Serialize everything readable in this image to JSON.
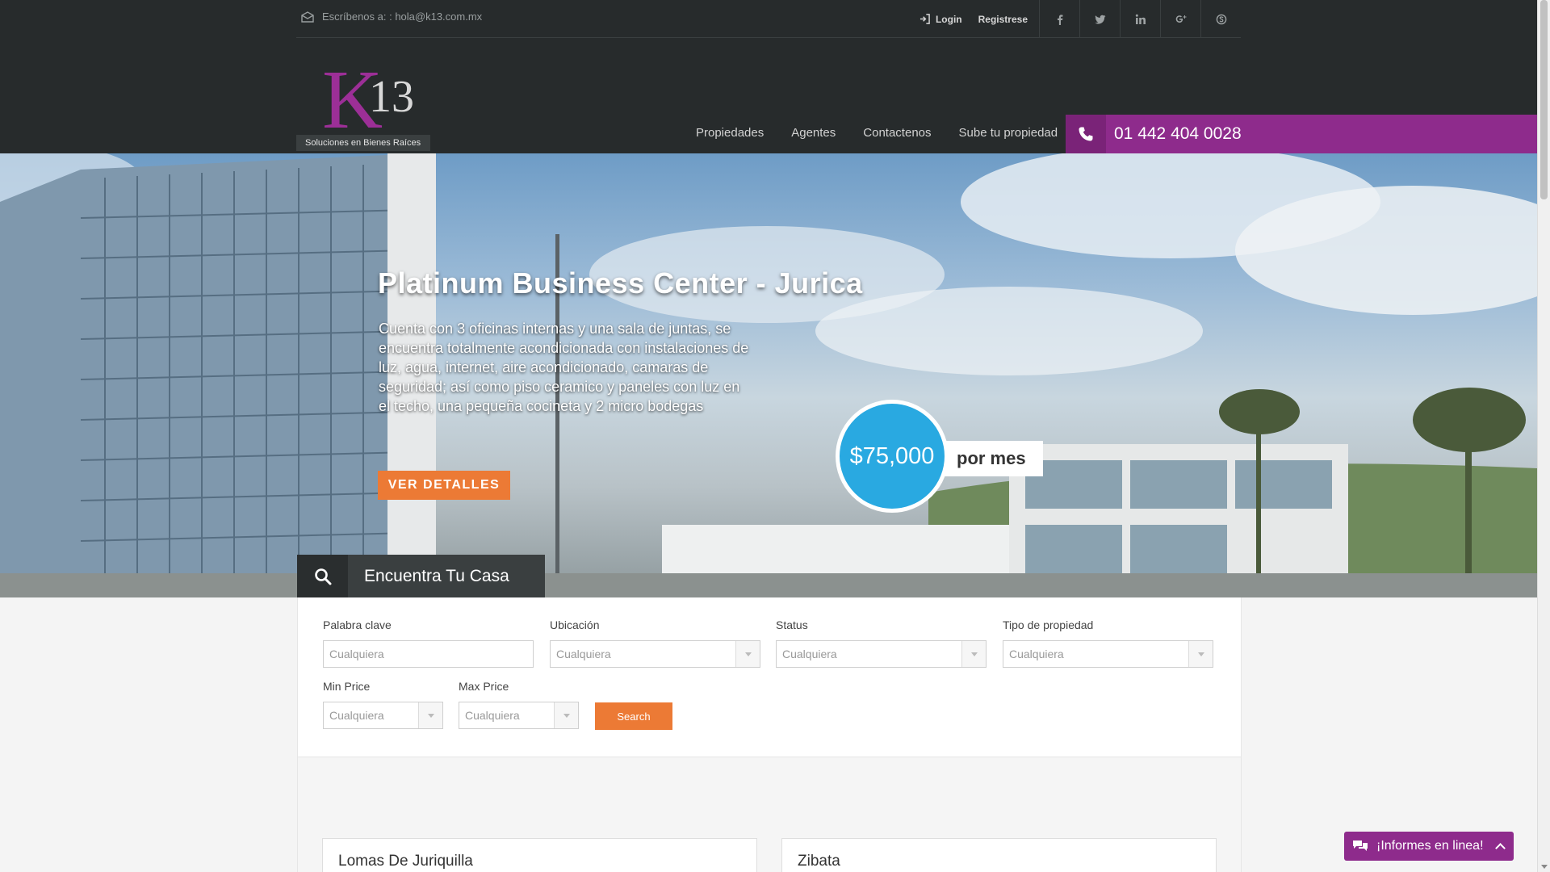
{
  "topbar": {
    "email_text": "Escríbenos a: : hola@k13.com.mx",
    "login": "Login",
    "register": "Registrese",
    "social": [
      "facebook-icon",
      "twitter-icon",
      "linkedin-icon",
      "google-plus-icon",
      "skype-icon"
    ]
  },
  "logo": {
    "k": "K",
    "num": "13",
    "tagline": "Soluciones en Bienes Raíces"
  },
  "nav": {
    "items": [
      "Propiedades",
      "Agentes",
      "Contactenos",
      "Sube tu propiedad"
    ],
    "phone": "01 442 404 0028"
  },
  "hero": {
    "title": "Platinum Business Center - Jurica",
    "description": "Cuenta con 3 oficinas internas y una sala de juntas, se encuentra totalmente acondicionada con instalaciones de luz, agua, internet, aire acondicionado, camaras de seguridad; así como piso ceramico y paneles con luz en el techo, una pequeña cocineta y 2 micro bodegas",
    "button": "VER DETALLES",
    "price": "$75,000",
    "price_period": "por mes"
  },
  "search": {
    "tab_title": "Encuentra Tu Casa",
    "fields": {
      "keyword": {
        "label": "Palabra clave",
        "placeholder": "Cualquiera"
      },
      "location": {
        "label": "Ubicación",
        "value": "Cualquiera"
      },
      "status": {
        "label": "Status",
        "value": "Cualquiera"
      },
      "type": {
        "label": "Tipo de propiedad",
        "value": "Cualquiera"
      },
      "min_price": {
        "label": "Min Price",
        "value": "Cualquiera"
      },
      "max_price": {
        "label": "Max Price",
        "value": "Cualquiera"
      }
    },
    "button": "Search"
  },
  "listings": [
    {
      "title": "Lomas De Juriquilla"
    },
    {
      "title": "Zibata"
    }
  ],
  "chat": {
    "label": "¡Informes en linea!"
  },
  "colors": {
    "purple": "#8e2b8c",
    "orange": "#ec7a35",
    "blue": "#29a9e1",
    "dark": "#272b2c"
  }
}
